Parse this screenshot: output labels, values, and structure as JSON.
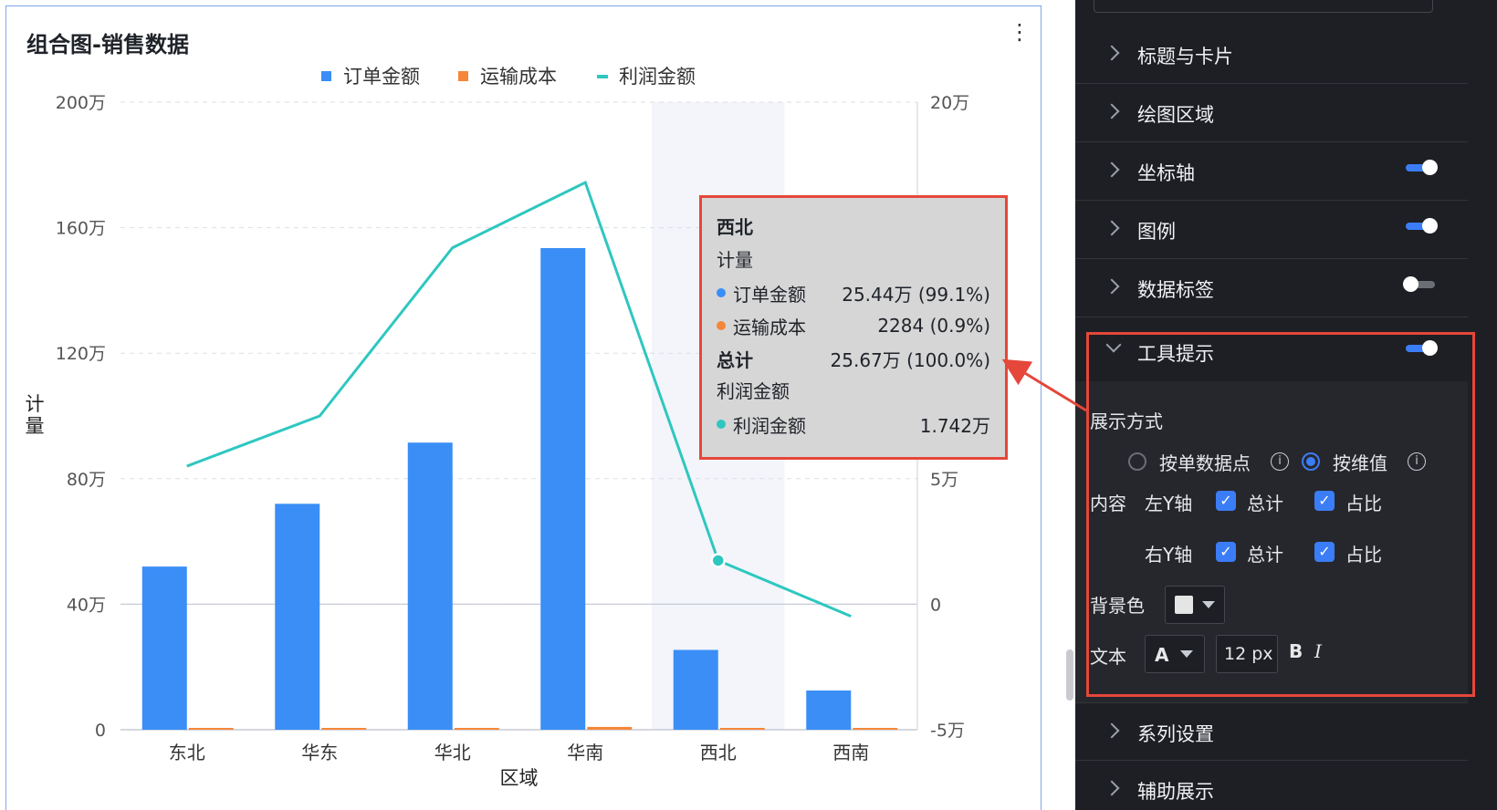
{
  "card": {
    "title": "组合图-销售数据",
    "more_icon": "more-vertical-icon"
  },
  "chart_data": {
    "type": "bar",
    "categories": [
      "东北",
      "华东",
      "华北",
      "华南",
      "西北",
      "西南"
    ],
    "xlabel": "区域",
    "ylabel": "计量",
    "y_left": {
      "ticks": [
        "200万",
        "160万",
        "120万",
        "80万",
        "40万",
        "0"
      ],
      "range": [
        0,
        2000000
      ]
    },
    "y_right": {
      "ticks": [
        "20万",
        "5万",
        "0",
        "-5万"
      ],
      "range": [
        -50000,
        200000
      ],
      "visible_tick_values": [
        200000,
        50000,
        0,
        -50000
      ]
    },
    "legend": [
      "订单金额",
      "运输成本",
      "利润金额"
    ],
    "legend_position": "top-center",
    "grid": true,
    "highlight_category": "西北",
    "series": [
      {
        "name": "订单金额",
        "type": "bar",
        "axis": "left",
        "color": "#3a8ef6",
        "values": [
          520000,
          720000,
          915000,
          1535000,
          254400,
          125000
        ]
      },
      {
        "name": "运输成本",
        "type": "bar",
        "axis": "left",
        "color": "#f5873a",
        "values": [
          3500,
          5000,
          5500,
          9000,
          2284,
          1500
        ]
      },
      {
        "name": "利润金额",
        "type": "line",
        "axis": "right",
        "color": "#2ec7c0",
        "values": [
          55000,
          75000,
          142000,
          168000,
          17420,
          -4800
        ]
      }
    ]
  },
  "tooltip": {
    "title": "西北",
    "group1": "计量",
    "rows": [
      {
        "label": "订单金额",
        "value": "25.44万 (99.1%)",
        "color": "#3a8ef6"
      },
      {
        "label": "运输成本",
        "value": "2284 (0.9%)",
        "color": "#f5873a"
      }
    ],
    "total_label": "总计",
    "total_value": "25.67万 (100.0%)",
    "group2": "利润金额",
    "rows2": [
      {
        "label": "利润金额",
        "value": "1.742万",
        "color": "#2ec7c0"
      }
    ]
  },
  "panel": {
    "sections_top": [
      {
        "label": "标题与卡片",
        "toggle": null
      },
      {
        "label": "绘图区域",
        "toggle": null
      },
      {
        "label": "坐标轴",
        "toggle": "on"
      },
      {
        "label": "图例",
        "toggle": "on"
      },
      {
        "label": "数据标签",
        "toggle": "off"
      }
    ],
    "tooltip_section": {
      "label": "工具提示",
      "toggle": "on",
      "display_mode_label": "展示方式",
      "mode_option1": "按单数据点",
      "mode_option2": "按维值",
      "content_label": "内容",
      "left_axis": "左Y轴",
      "right_axis": "右Y轴",
      "total": "总计",
      "ratio": "占比",
      "bg_label": "背景色",
      "text_label": "文本",
      "font_glyph": "A",
      "font_size": "12 px",
      "bold": "B",
      "italic": "I"
    },
    "sections_bottom": [
      {
        "label": "系列设置"
      },
      {
        "label": "辅助展示"
      }
    ]
  }
}
